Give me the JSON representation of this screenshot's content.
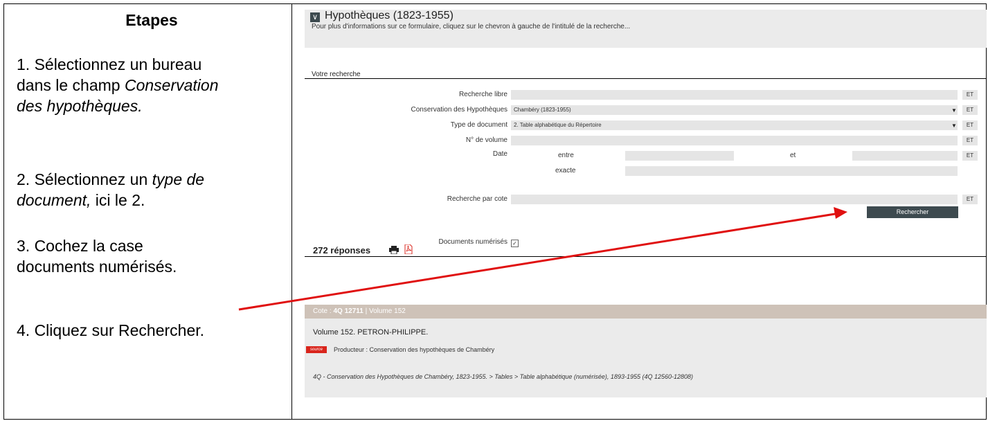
{
  "instructions": {
    "title": "Etapes",
    "step1": [
      "1. Sélectionnez un bureau",
      "dans le champ ",
      "Conservation",
      "des hypothèques."
    ],
    "step2": [
      "2. Sélectionnez un ",
      "type de",
      "document,",
      " ici le 2."
    ],
    "step3": [
      "3. Cochez la case",
      "documents numérisés."
    ],
    "step4": "4. Cliquez sur Rechercher."
  },
  "header": {
    "chevron": "∨",
    "title": "Hypothèques (1823-1955)",
    "subtitle": "Pour plus d'informations sur ce formulaire, cliquez sur le chevron à gauche de l'intitulé de la recherche..."
  },
  "form": {
    "section_label": "Votre recherche",
    "recherche_libre_label": "Recherche libre",
    "recherche_libre_value": "",
    "conservation_label": "Conservation des Hypothèques",
    "conservation_value": "Chambéry (1823-1955)",
    "type_label": "Type de document",
    "type_value": "2. Table alphabétique du Répertoire",
    "volume_label": "N° de volume",
    "volume_value": "",
    "date_label": "Date",
    "entre_label": "entre",
    "et_label": "et",
    "exacte_label": "exacte",
    "numerises_label": "Documents numérisés",
    "numerises_checked": "✓",
    "cote_label": "Recherche par cote",
    "cote_value": "",
    "et_button": "ET",
    "dropdown_arrow": "▼",
    "submit_label": "Rechercher"
  },
  "results": {
    "count_label": "272  réponses",
    "icons": [
      "printer-icon",
      "pdf-icon"
    ]
  },
  "result_card": {
    "cote_prefix": "Cote : ",
    "cote_value": "4Q 12711",
    "volume_text": " | Volume 152",
    "title": "Volume 152. PETRON-PHILIPPE.",
    "source_tag": "source",
    "producer": "Producteur : Conservation des hypothèques de Chambéry",
    "breadcrumb": "4Q - Conservation des Hypothèques de Chambéry, 1823-1955. > Tables > Table alphabétique (numérisée), 1893-1955 (4Q 12560-12808)"
  },
  "colors": {
    "annotation_line": "#e01010",
    "button_bg": "#3d4a4f",
    "card_header": "#cec2b8",
    "field_bg": "#e5e5e5"
  }
}
